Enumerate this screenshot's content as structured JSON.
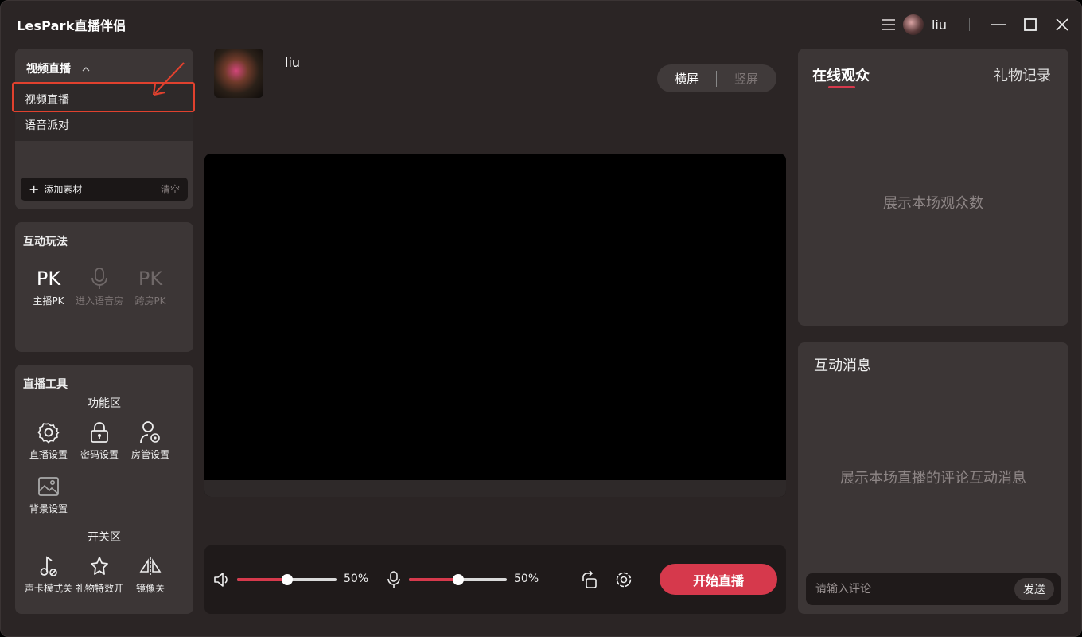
{
  "app": {
    "title": "LesPark直播伴侣"
  },
  "user": {
    "name": "liu"
  },
  "source": {
    "selected": "视频直播",
    "options": [
      "视频直播",
      "语音派对"
    ],
    "add_label": "添加素材",
    "clear_label": "清空"
  },
  "interact": {
    "title": "互动玩法",
    "tools": [
      {
        "label": "主播PK",
        "glyph": "PK",
        "enabled": true
      },
      {
        "label": "进入语音房",
        "enabled": false
      },
      {
        "label": "跨房PK",
        "glyph": "PK",
        "enabled": false
      }
    ]
  },
  "live_tools": {
    "title": "直播工具",
    "function_section": "功能区",
    "functions": [
      "直播设置",
      "密码设置",
      "房管设置",
      "背景设置"
    ],
    "switch_section": "开关区",
    "switches": [
      "声卡模式关",
      "礼物特效开",
      "镜像关"
    ]
  },
  "host": {
    "name": "liu"
  },
  "orientation": {
    "landscape": "横屏",
    "portrait": "竖屏",
    "active": "横屏"
  },
  "controls": {
    "speaker_volume": 50,
    "speaker_label": "50%",
    "mic_volume": 50,
    "mic_label": "50%",
    "start_label": "开始直播"
  },
  "audience": {
    "tab_active": "在线观众",
    "tab_other": "礼物记录",
    "placeholder": "展示本场观众数"
  },
  "messages": {
    "title": "互动消息",
    "placeholder": "展示本场直播的评论互动消息",
    "input_placeholder": "请输入评论",
    "send_label": "发送"
  },
  "colors": {
    "accent": "#d6394c",
    "highlight": "#e0412e",
    "panel": "#3c3636",
    "background": "#2b2525"
  }
}
